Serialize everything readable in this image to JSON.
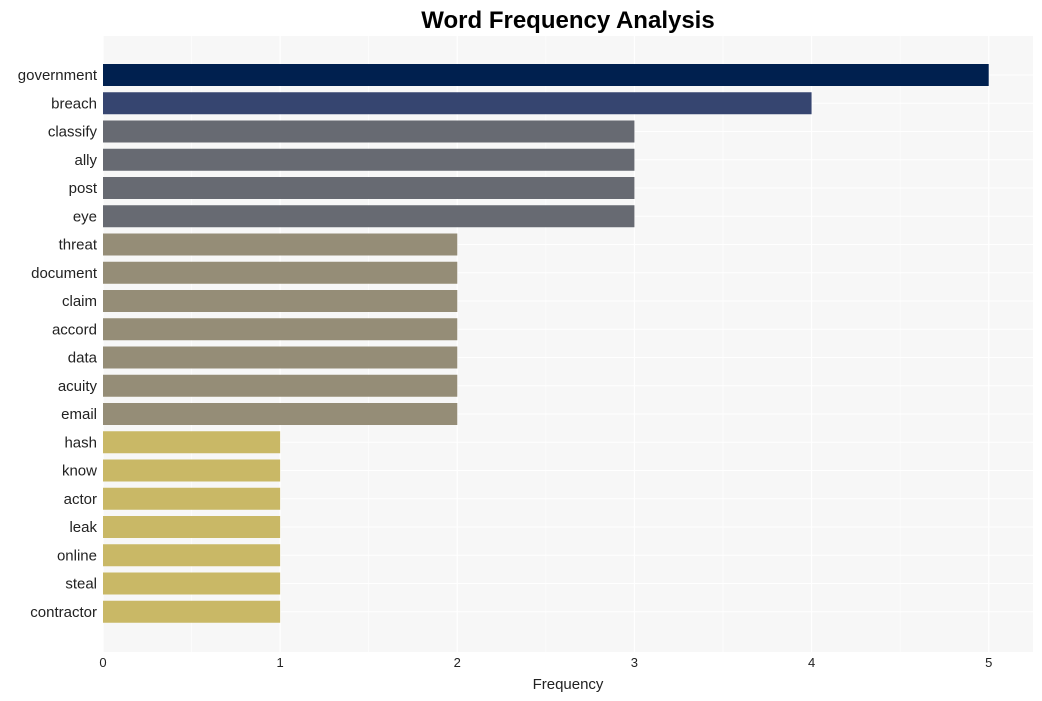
{
  "chart_data": {
    "type": "bar",
    "orientation": "horizontal",
    "title": "Word Frequency Analysis",
    "xlabel": "Frequency",
    "ylabel": "",
    "xlim": [
      0,
      5.25
    ],
    "xticks": [
      0,
      1,
      2,
      3,
      4,
      5
    ],
    "grid": true,
    "legend": "none",
    "categories": [
      "government",
      "breach",
      "classify",
      "ally",
      "post",
      "eye",
      "threat",
      "document",
      "claim",
      "accord",
      "data",
      "acuity",
      "email",
      "hash",
      "know",
      "actor",
      "leak",
      "online",
      "steal",
      "contractor"
    ],
    "values": [
      5,
      4,
      3,
      3,
      3,
      3,
      2,
      2,
      2,
      2,
      2,
      2,
      2,
      1,
      1,
      1,
      1,
      1,
      1,
      1
    ],
    "colors": [
      "#00204f",
      "#364570",
      "#676a72",
      "#676a72",
      "#676a72",
      "#676a72",
      "#958d77",
      "#958d77",
      "#958d77",
      "#958d77",
      "#958d77",
      "#958d77",
      "#958d77",
      "#c9b866",
      "#c9b866",
      "#c9b866",
      "#c9b866",
      "#c9b866",
      "#c9b866",
      "#c9b866"
    ]
  }
}
